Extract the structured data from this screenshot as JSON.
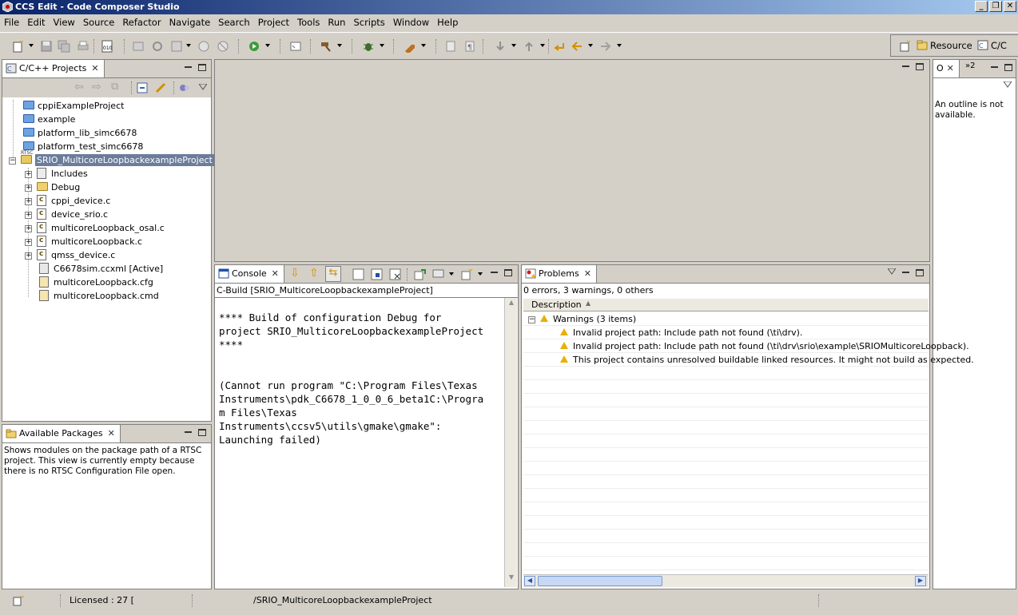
{
  "window": {
    "title": "CCS Edit - Code Composer Studio"
  },
  "menu": [
    "File",
    "Edit",
    "View",
    "Source",
    "Refactor",
    "Navigate",
    "Search",
    "Project",
    "Tools",
    "Run",
    "Scripts",
    "Window",
    "Help"
  ],
  "perspectives": {
    "resource": "Resource",
    "cc": "C/C"
  },
  "projects_view": {
    "tab": "C/C++ Projects",
    "items": [
      {
        "label": "cppiExampleProject",
        "kind": "folder"
      },
      {
        "label": "example",
        "kind": "folder"
      },
      {
        "label": "platform_lib_simc6678",
        "kind": "folder"
      },
      {
        "label": "platform_test_simc6678",
        "kind": "folder"
      },
      {
        "label": "SRIO_MulticoreLoopbackexampleProject",
        "kind": "project",
        "badge": "RTSC"
      },
      {
        "label": "Includes",
        "kind": "includes"
      },
      {
        "label": "Debug",
        "kind": "folder-open"
      },
      {
        "label": "cppi_device.c",
        "kind": "c"
      },
      {
        "label": "device_srio.c",
        "kind": "c"
      },
      {
        "label": "multicoreLoopback_osal.c",
        "kind": "c"
      },
      {
        "label": "multicoreLoopback.c",
        "kind": "c"
      },
      {
        "label": "qmss_device.c",
        "kind": "c"
      },
      {
        "label": "C6678sim.ccxml [Active]",
        "kind": "xml"
      },
      {
        "label": "multicoreLoopback.cfg",
        "kind": "cfg"
      },
      {
        "label": "multicoreLoopback.cmd",
        "kind": "cmd"
      }
    ]
  },
  "packages_view": {
    "tab": "Available Packages",
    "message": "Shows modules on the package path of a RTSC project. This view is currently empty because there is no RTSC Configuration File open."
  },
  "outline_view": {
    "tab": "O",
    "overflow": "»2",
    "message": "An outline is not available."
  },
  "console": {
    "tab": "Console",
    "subtitle": "C-Build [SRIO_MulticoreLoopbackexampleProject]",
    "lines": [
      "**** Build of configuration Debug for",
      "project SRIO_MulticoreLoopbackexampleProject",
      "****",
      "",
      "",
      "(Cannot run program \"C:\\Program Files\\Texas",
      "Instruments\\pdk_C6678_1_0_0_6_beta1C:\\Progra",
      "m Files\\Texas",
      "Instruments\\ccsv5\\utils\\gmake\\gmake\":",
      "Launching failed)"
    ]
  },
  "problems": {
    "tab": "Problems",
    "summary": "0 errors, 3 warnings, 0 others",
    "column": "Description",
    "group": "Warnings (3 items)",
    "items": [
      "Invalid project path: Include path not found (\\ti\\drv).",
      "Invalid project path: Include path not found (\\ti\\drv\\srio\\example\\SRIOMulticoreLoopback).",
      "This project contains unresolved buildable linked resources. It might not build as expected."
    ]
  },
  "status": {
    "license": "Licensed : 27 [",
    "path": "/SRIO_MulticoreLoopbackexampleProject"
  }
}
